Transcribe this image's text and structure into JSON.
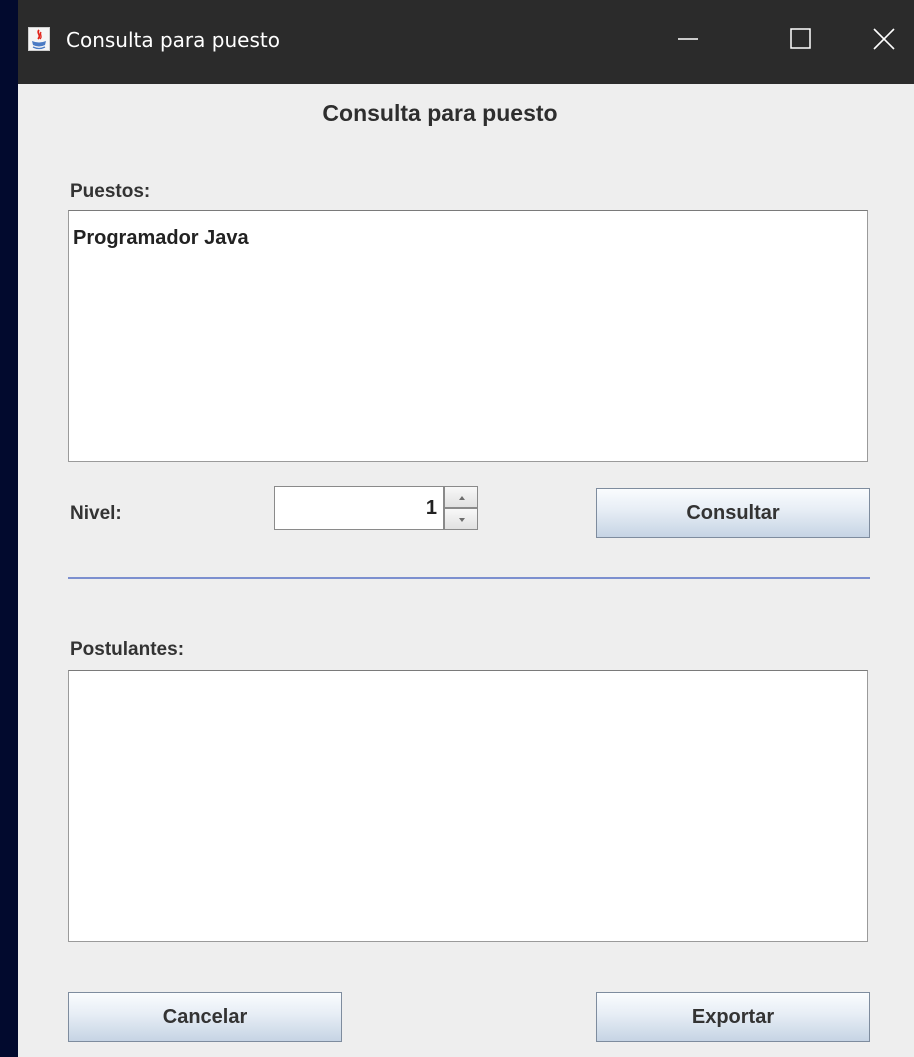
{
  "window": {
    "title": "Consulta para puesto",
    "icon": "java-icon",
    "controls": [
      "minimize-icon",
      "maximize-icon",
      "close-icon"
    ]
  },
  "dialog": {
    "heading": "Consulta para puesto"
  },
  "puestos": {
    "label": "Puestos:",
    "items": [
      "Programador Java"
    ]
  },
  "nivel": {
    "label": "Nivel:",
    "value": "1"
  },
  "buttons": {
    "consultar": "Consultar",
    "cancelar": "Cancelar",
    "exportar": "Exportar"
  },
  "postulantes": {
    "label": "Postulantes:",
    "items": []
  },
  "colors": {
    "titlebar": "#2b2b2b",
    "window_bg": "#eeeeee",
    "desktop_bg": "#020a2e",
    "separator": "#7c8fcf"
  }
}
